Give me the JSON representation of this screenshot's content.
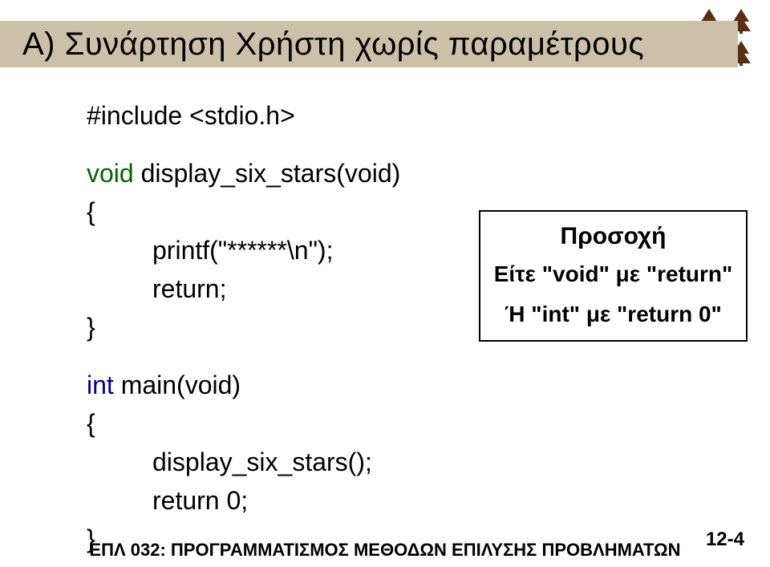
{
  "title": "Α) Συνάρτηση Χρήστη χωρίς παραμέτρους",
  "code": {
    "l1": "#include <stdio.h>",
    "l2_void": "void",
    "l2_rest": " display_six_stars(void)",
    "l3": "{",
    "l4": "printf(\"******\\n\");",
    "l5": "return;",
    "l6": "}",
    "l7_int": "int",
    "l7_rest": " main(void)",
    "l8": "{",
    "l9": "display_six_stars();",
    "l10": "return 0;",
    "l11": "}"
  },
  "callout": {
    "line1": "Προσοχή",
    "line2": "Είτε \"void\" με \"return\"",
    "line3": "Ή \"int\" με \"return 0\""
  },
  "footer": "ΕΠΛ 032: ΠΡΟΓΡΑΜΜΑΤΙΣΜΟΣ ΜΕΘΟΔΩΝ ΕΠΙΛΥΣΗΣ ΠΡΟΒΛΗΜΑΤΩΝ",
  "page": "12-4"
}
